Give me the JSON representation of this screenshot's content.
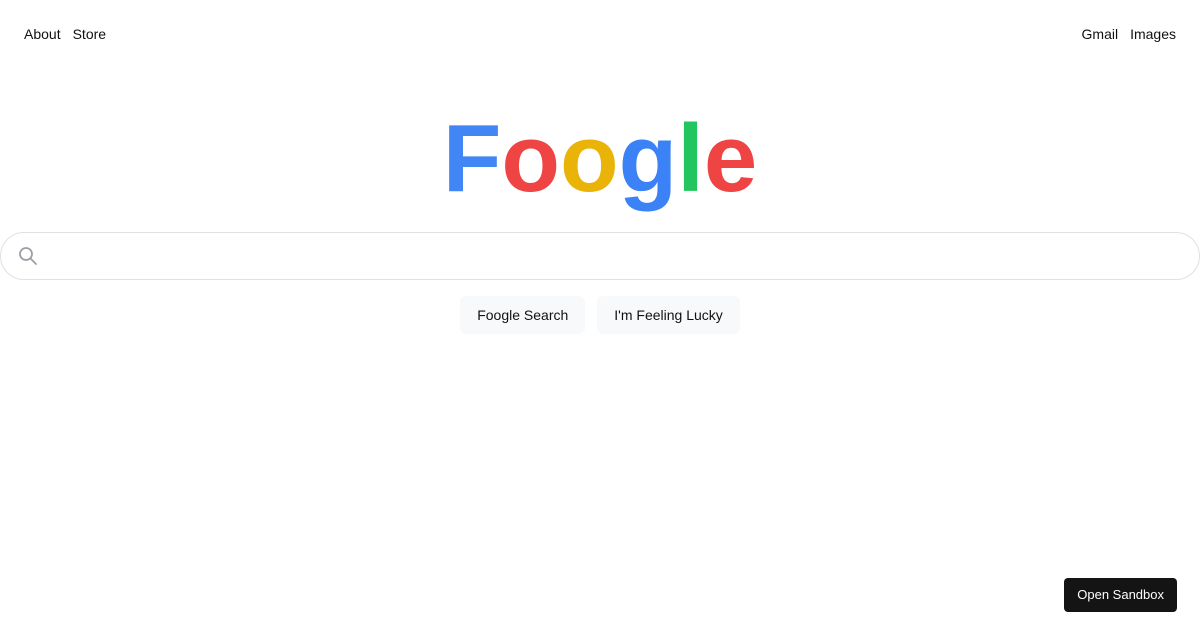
{
  "nav": {
    "left": [
      {
        "label": "About"
      },
      {
        "label": "Store"
      }
    ],
    "right": [
      {
        "label": "Gmail"
      },
      {
        "label": "Images"
      }
    ]
  },
  "logo": {
    "letters": [
      {
        "char": "F",
        "color": "#4285f4"
      },
      {
        "char": "o",
        "color": "#ef4444"
      },
      {
        "char": "o",
        "color": "#eab308"
      },
      {
        "char": "g",
        "color": "#3b82f6"
      },
      {
        "char": "l",
        "color": "#22c55e"
      },
      {
        "char": "e",
        "color": "#ef4444"
      }
    ]
  },
  "search": {
    "icon": "search-icon",
    "value": "",
    "placeholder": ""
  },
  "buttons": {
    "search_label": "Foogle Search",
    "lucky_label": "I'm Feeling Lucky"
  },
  "sandbox": {
    "label": "Open Sandbox"
  },
  "colors": {
    "search_border": "#dfe1e5",
    "button_bg": "#f8f9fa",
    "sandbox_bg": "#141414",
    "icon": "#9aa0a6"
  }
}
